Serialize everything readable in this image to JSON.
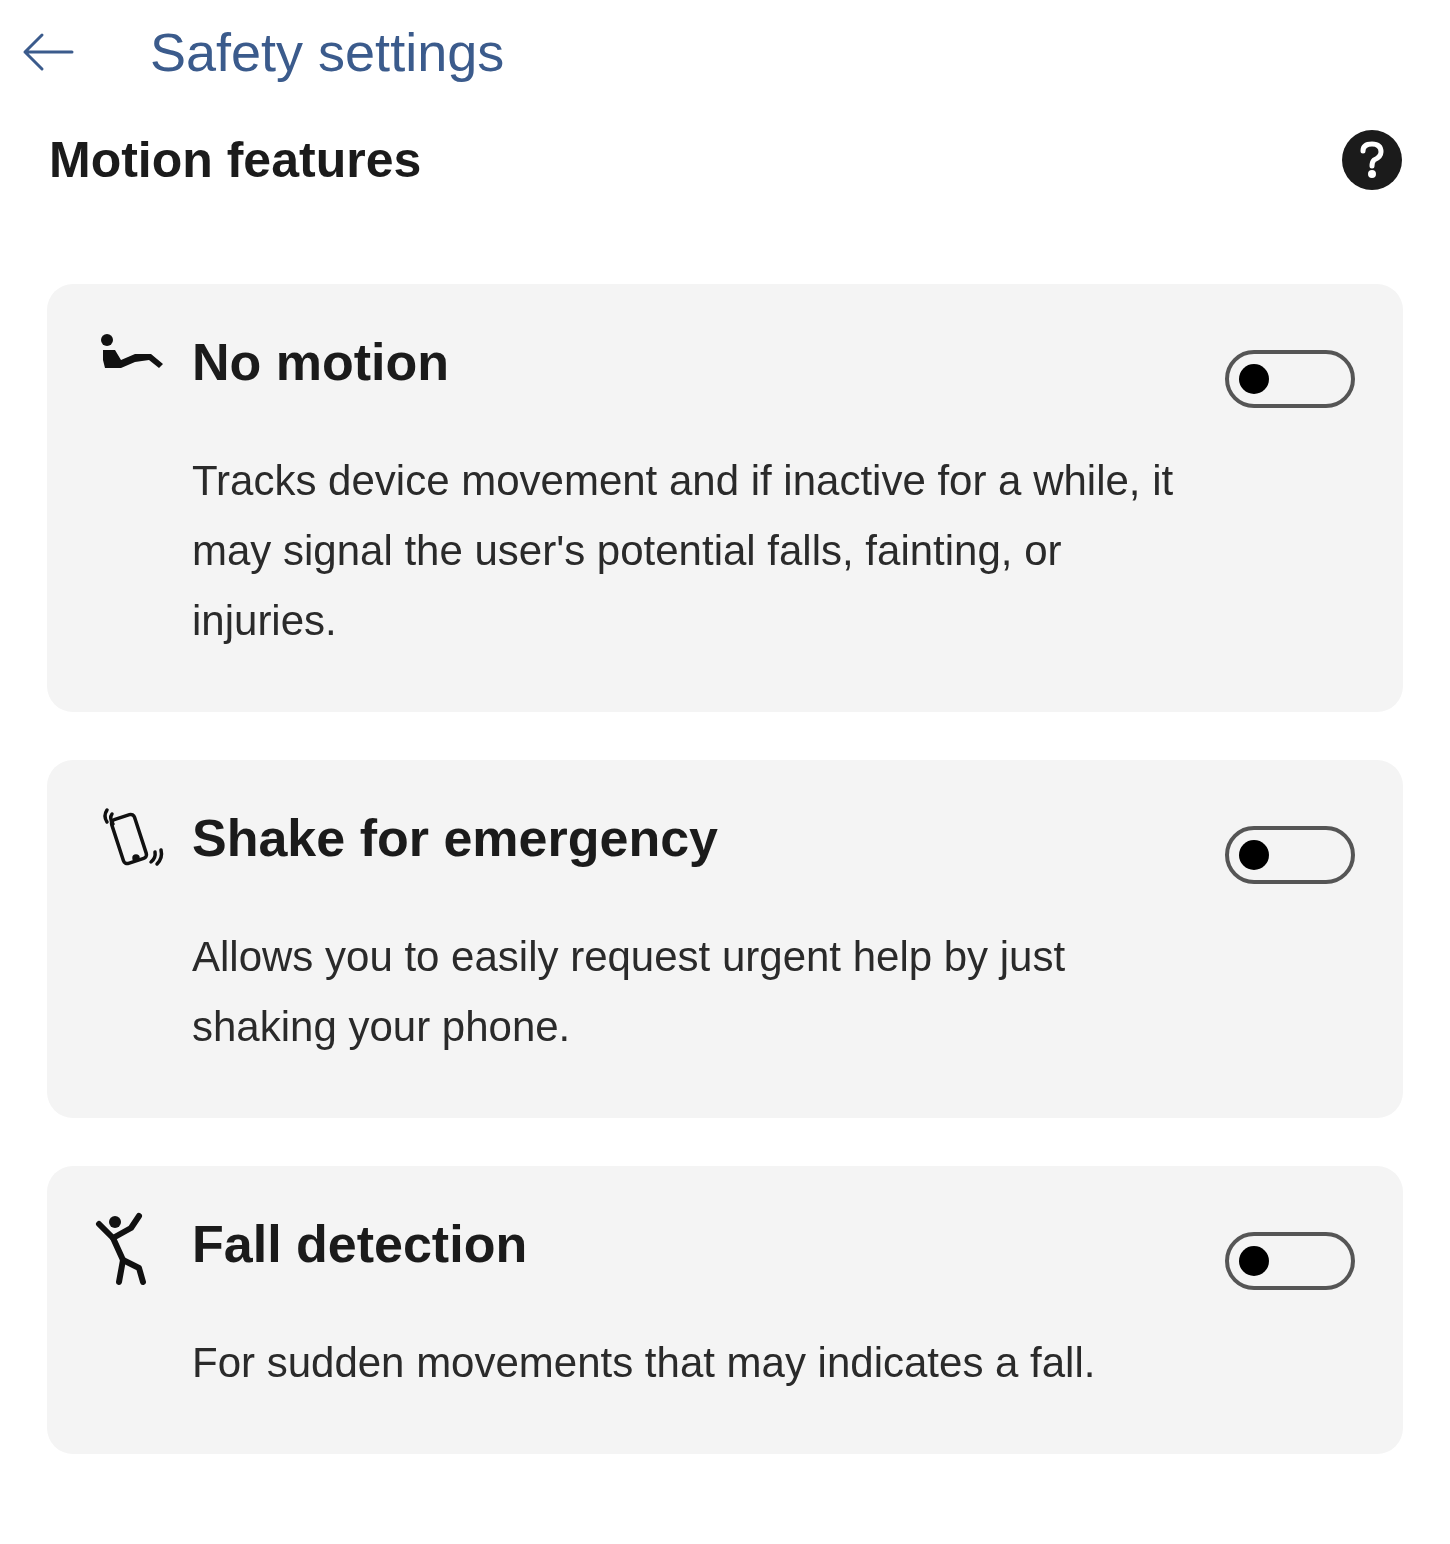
{
  "header": {
    "title": "Safety settings"
  },
  "section": {
    "title": "Motion features"
  },
  "features": [
    {
      "kind": "lying",
      "title": "No motion",
      "description": "Tracks device movement and if inactive for a while, it may signal the user's potential falls, fainting, or injuries.",
      "on": false
    },
    {
      "kind": "shake",
      "title": "Shake for emergency",
      "description": "Allows you to easily request urgent help by just shaking your phone.",
      "on": false
    },
    {
      "kind": "fall",
      "title": "Fall detection",
      "description": "For sudden movements that may indicates a fall.",
      "on": false
    }
  ]
}
